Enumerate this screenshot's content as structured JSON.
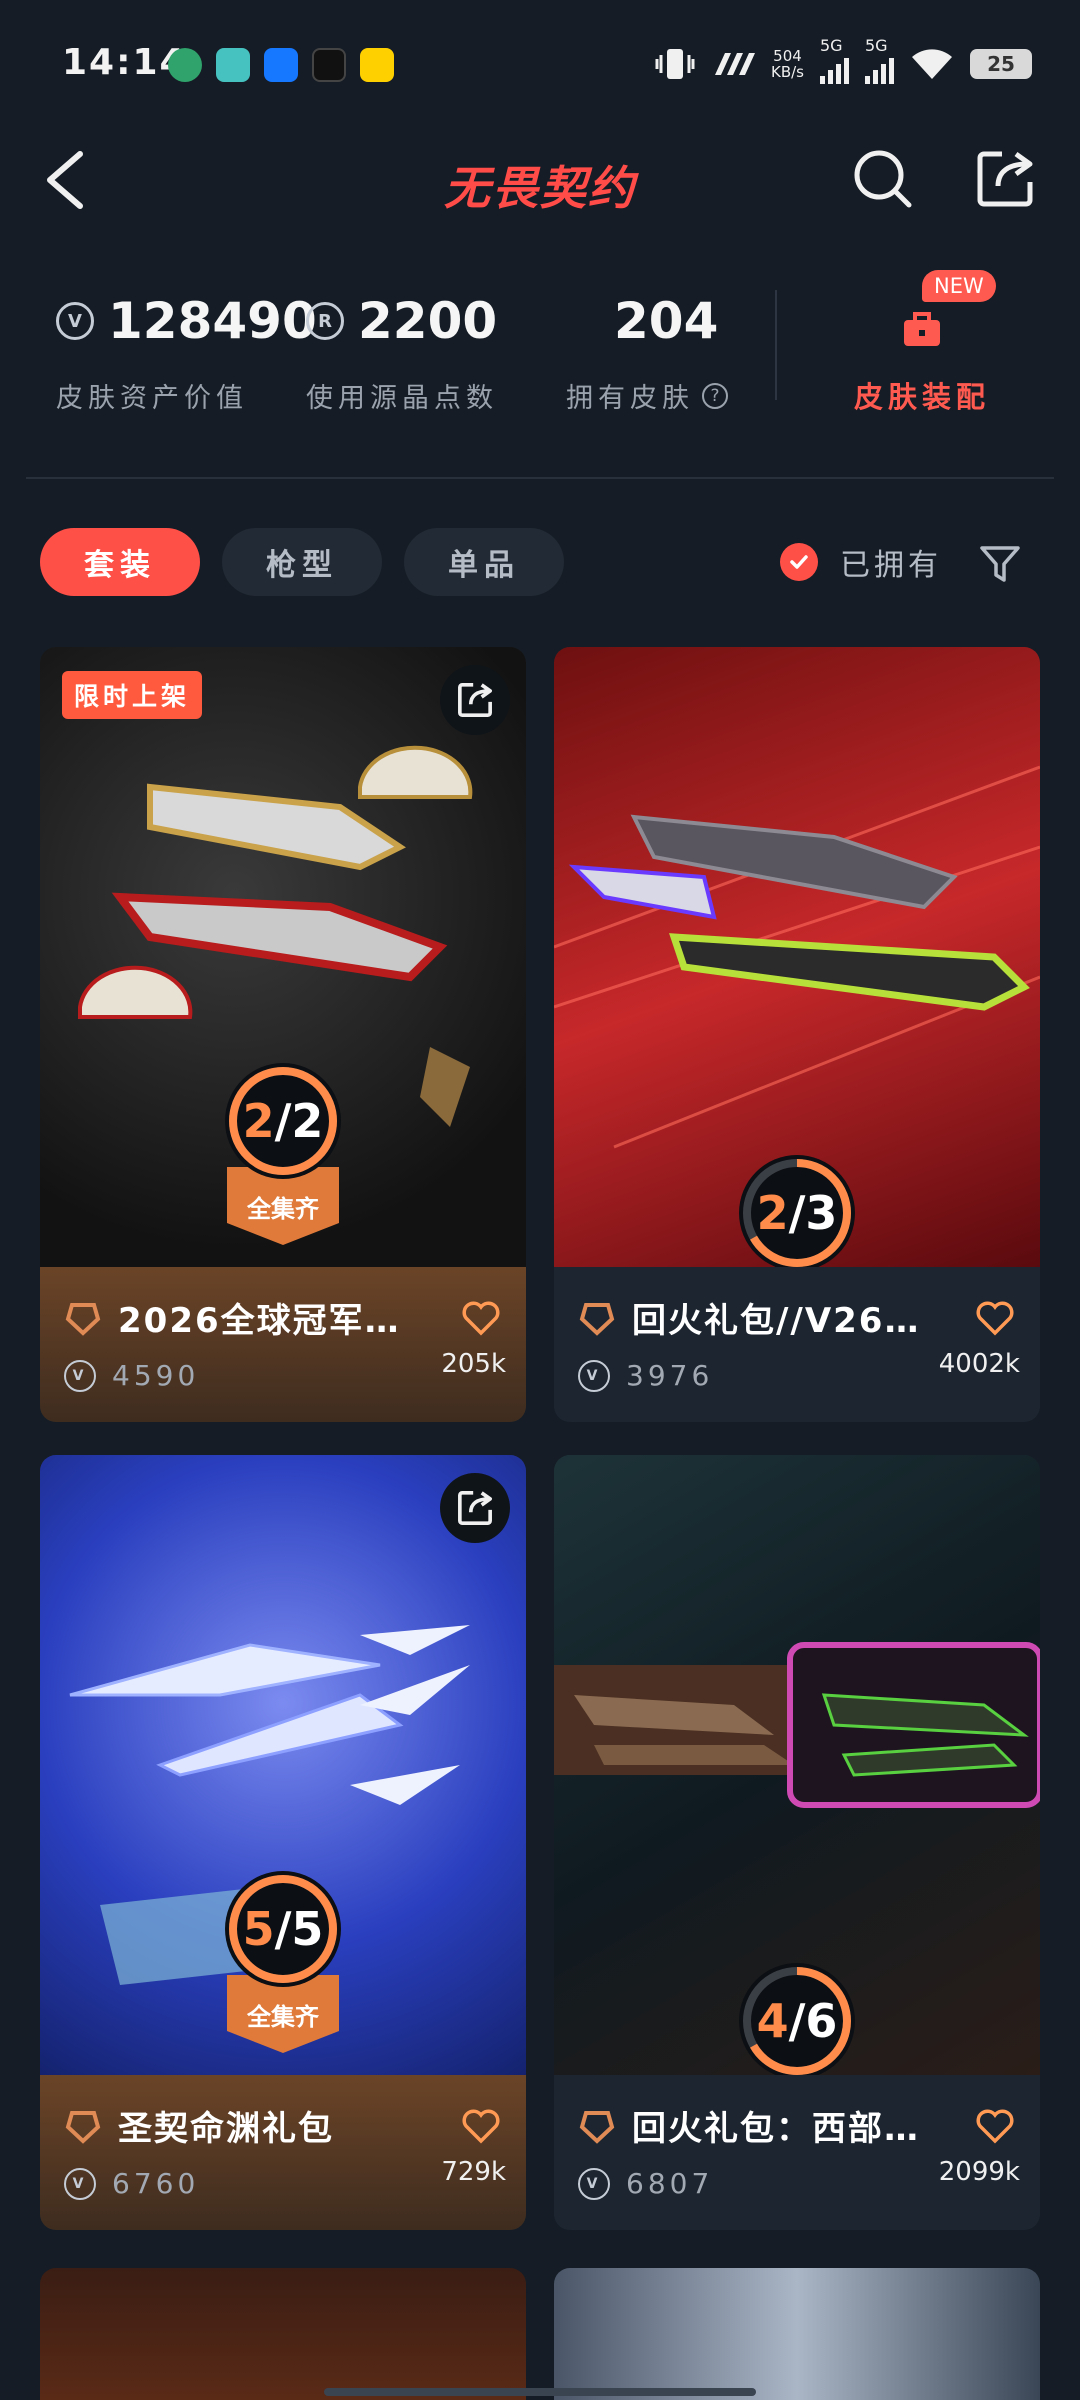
{
  "status_bar": {
    "time": "14:14",
    "netspeed_value": "504",
    "netspeed_unit": "KB/s",
    "signal1": "5G",
    "signal2": "5G",
    "battery": "25"
  },
  "header": {
    "title": "无畏契约",
    "back_icon": "back-chevron-icon",
    "search_icon": "search-icon",
    "share_icon": "share-icon"
  },
  "stats": {
    "asset_value": "128490",
    "asset_label": "皮肤资产价值",
    "radianite_points": "2200",
    "radianite_label": "使用源晶点数",
    "owned_skins": "204",
    "owned_label": "拥有皮肤",
    "new_badge": "NEW",
    "loadout_label": "皮肤装配"
  },
  "filters": {
    "tabs": [
      "套装",
      "枪型",
      "单品"
    ],
    "active_tab": "套装",
    "owned_toggle": "已拥有",
    "owned_checked": true
  },
  "colors": {
    "accent": "#ff5048",
    "background": "#151c25",
    "progress": "#ff8c4a"
  },
  "cards": [
    {
      "tag": "限时上架",
      "owned": "2",
      "total": "2",
      "progress": 1.0,
      "collected_label": "全集齐",
      "name": "2026全球冠军赛…",
      "price": "4590",
      "likes": "205k",
      "style": "gold"
    },
    {
      "owned": "2",
      "total": "3",
      "progress": 0.6667,
      "name": "回火礼包//V26…",
      "price": "3976",
      "likes": "4002k",
      "style": "dark"
    },
    {
      "owned": "5",
      "total": "5",
      "progress": 1.0,
      "collected_label": "全集齐",
      "name": "圣契命渊礼包",
      "price": "6760",
      "likes": "729k",
      "style": "gold"
    },
    {
      "owned": "4",
      "total": "6",
      "progress": 0.6667,
      "name": "回火礼包：西部…",
      "price": "6807",
      "likes": "2099k",
      "style": "dark"
    }
  ]
}
